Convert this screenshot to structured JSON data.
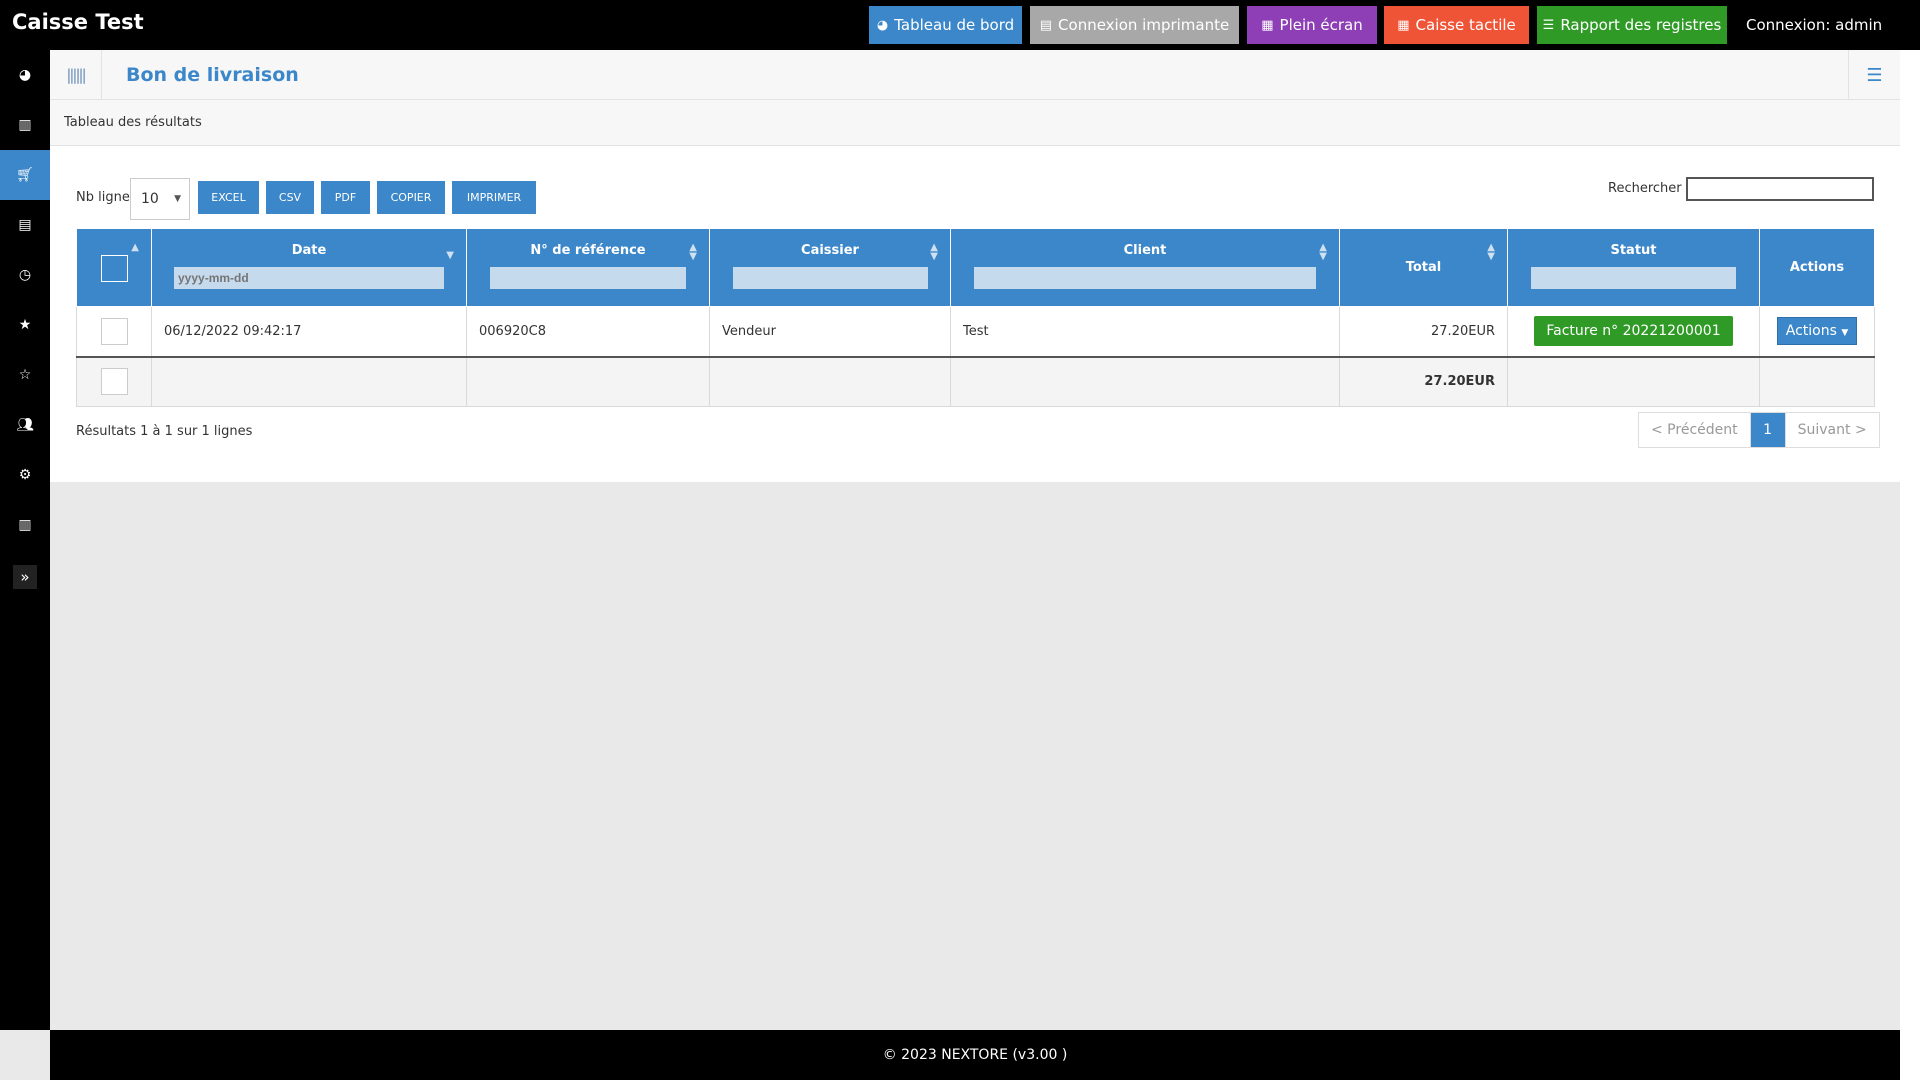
{
  "app": {
    "title": "Caisse Test",
    "login": "Connexion: admin"
  },
  "topbar": {
    "buttons": [
      {
        "label": "Tableau de bord",
        "color": "#3c87c9",
        "icon": "dashboard-icon"
      },
      {
        "label": "Connexion imprimante",
        "color": "#a8a8a8",
        "icon": "printer-icon"
      },
      {
        "label": "Plein écran",
        "color": "#8e3fb5",
        "icon": "grid-icon"
      },
      {
        "label": "Caisse tactile",
        "color": "#f05436",
        "icon": "grid-icon"
      },
      {
        "label": "Rapport des registres",
        "color": "#2f9a26",
        "icon": "list-icon"
      }
    ]
  },
  "sidebar": {
    "items": [
      "dashboard-icon",
      "barcode-icon",
      "cart-icon",
      "document-icon",
      "clock-icon",
      "star-icon",
      "star-outline-icon",
      "users-icon",
      "gear-icon",
      "chart-icon"
    ],
    "active_index": 2
  },
  "panel": {
    "title": "Bon de livraison",
    "subtitle": "Tableau des résultats"
  },
  "controls": {
    "nb_label": "Nb ligne",
    "nb_value": "10",
    "export_buttons": [
      "EXCEL",
      "CSV",
      "PDF",
      "COPIER",
      "IMPRIMER"
    ],
    "search_label": "Rechercher",
    "search_value": ""
  },
  "table": {
    "columns": [
      "Date",
      "N° de référence",
      "Caissier",
      "Client",
      "Total",
      "Statut",
      "Actions"
    ],
    "date_filter_placeholder": "yyyy-mm-dd",
    "rows": [
      {
        "date": "06/12/2022 09:42:17",
        "ref": "006920C8",
        "caissier": "Vendeur",
        "client": "Test",
        "total": "27.20EUR",
        "statut": "Facture n° 20221200001",
        "actions": "Actions"
      }
    ],
    "footer_total": "27.20EUR"
  },
  "pagination": {
    "results": "Résultats 1 à 1 sur 1 lignes",
    "prev": "< Précédent",
    "current": "1",
    "next": "Suivant >"
  },
  "footer": {
    "text": "© 2023 NEXTORE (v3.00 )"
  }
}
